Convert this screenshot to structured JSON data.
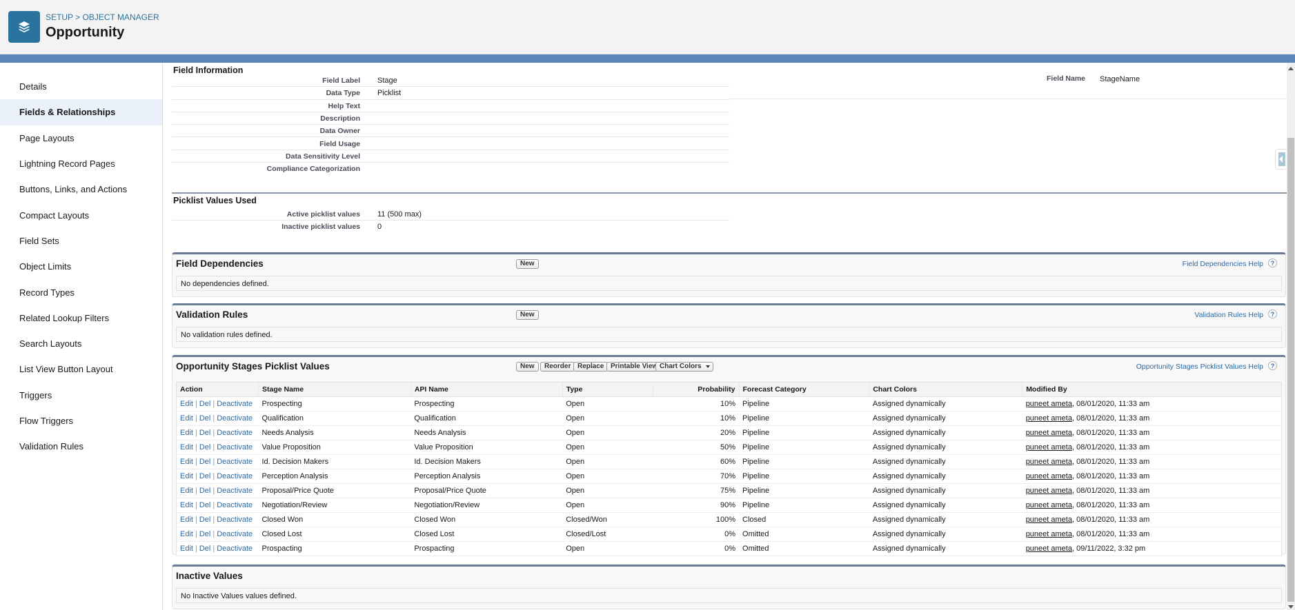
{
  "header": {
    "breadcrumb": {
      "setup": "SETUP",
      "separator": " > ",
      "object_manager": "OBJECT MANAGER"
    },
    "title": "Opportunity",
    "logo_icon": "layers-icon"
  },
  "sidebar": {
    "items": [
      {
        "label": "Details",
        "active": false
      },
      {
        "label": "Fields & Relationships",
        "active": true
      },
      {
        "label": "Page Layouts",
        "active": false
      },
      {
        "label": "Lightning Record Pages",
        "active": false
      },
      {
        "label": "Buttons, Links, and Actions",
        "active": false
      },
      {
        "label": "Compact Layouts",
        "active": false
      },
      {
        "label": "Field Sets",
        "active": false
      },
      {
        "label": "Object Limits",
        "active": false
      },
      {
        "label": "Record Types",
        "active": false
      },
      {
        "label": "Related Lookup Filters",
        "active": false
      },
      {
        "label": "Search Layouts",
        "active": false
      },
      {
        "label": "List View Button Layout",
        "active": false
      },
      {
        "label": "Triggers",
        "active": false
      },
      {
        "label": "Flow Triggers",
        "active": false
      },
      {
        "label": "Validation Rules",
        "active": false
      }
    ]
  },
  "field_info": {
    "heading": "Field Information",
    "rows": [
      {
        "label": "Field Label",
        "value": "Stage"
      },
      {
        "label": "Data Type",
        "value": "Picklist"
      },
      {
        "label": "Help Text",
        "value": ""
      },
      {
        "label": "Description",
        "value": ""
      },
      {
        "label": "Data Owner",
        "value": ""
      },
      {
        "label": "Field Usage",
        "value": ""
      },
      {
        "label": "Data Sensitivity Level",
        "value": ""
      },
      {
        "label": "Compliance Categorization",
        "value": ""
      }
    ],
    "field_name_label": "Field Name",
    "field_name_value": "StageName"
  },
  "picklist_used": {
    "heading": "Picklist Values Used",
    "rows": [
      {
        "label": "Active picklist values",
        "value": "11 (500 max)"
      },
      {
        "label": "Inactive picklist values",
        "value": "0"
      }
    ]
  },
  "field_dependencies": {
    "heading": "Field Dependencies",
    "new_label": "New",
    "help_label": "Field Dependencies Help",
    "empty_text": "No dependencies defined."
  },
  "validation_rules": {
    "heading": "Validation Rules",
    "new_label": "New",
    "help_label": "Validation Rules Help",
    "empty_text": "No validation rules defined."
  },
  "stages": {
    "heading": "Opportunity Stages Picklist Values",
    "buttons": {
      "new": "New",
      "reorder": "Reorder",
      "replace": "Replace",
      "printable": "Printable View",
      "chart_colors": "Chart Colors"
    },
    "help_label": "Opportunity Stages Picklist Values Help",
    "columns": [
      "Action",
      "Stage Name",
      "API Name",
      "Type",
      "Probability",
      "Forecast Category",
      "Chart Colors",
      "Modified By"
    ],
    "action_links": {
      "edit": "Edit",
      "del": "Del",
      "deactivate": "Deactivate"
    },
    "rows": [
      {
        "stage": "Prospecting",
        "api": "Prospecting",
        "type": "Open",
        "probability": "10%",
        "forecast": "Pipeline",
        "color": "Assigned dynamically",
        "user": "puneet ameta",
        "date": ", 08/01/2020, 11:33 am"
      },
      {
        "stage": "Qualification",
        "api": "Qualification",
        "type": "Open",
        "probability": "10%",
        "forecast": "Pipeline",
        "color": "Assigned dynamically",
        "user": "puneet ameta",
        "date": ", 08/01/2020, 11:33 am"
      },
      {
        "stage": "Needs Analysis",
        "api": "Needs Analysis",
        "type": "Open",
        "probability": "20%",
        "forecast": "Pipeline",
        "color": "Assigned dynamically",
        "user": "puneet ameta",
        "date": ", 08/01/2020, 11:33 am"
      },
      {
        "stage": "Value Proposition",
        "api": "Value Proposition",
        "type": "Open",
        "probability": "50%",
        "forecast": "Pipeline",
        "color": "Assigned dynamically",
        "user": "puneet ameta",
        "date": ", 08/01/2020, 11:33 am"
      },
      {
        "stage": "Id. Decision Makers",
        "api": "Id. Decision Makers",
        "type": "Open",
        "probability": "60%",
        "forecast": "Pipeline",
        "color": "Assigned dynamically",
        "user": "puneet ameta",
        "date": ", 08/01/2020, 11:33 am"
      },
      {
        "stage": "Perception Analysis",
        "api": "Perception Analysis",
        "type": "Open",
        "probability": "70%",
        "forecast": "Pipeline",
        "color": "Assigned dynamically",
        "user": "puneet ameta",
        "date": ", 08/01/2020, 11:33 am"
      },
      {
        "stage": "Proposal/Price Quote",
        "api": "Proposal/Price Quote",
        "type": "Open",
        "probability": "75%",
        "forecast": "Pipeline",
        "color": "Assigned dynamically",
        "user": "puneet ameta",
        "date": ", 08/01/2020, 11:33 am"
      },
      {
        "stage": "Negotiation/Review",
        "api": "Negotiation/Review",
        "type": "Open",
        "probability": "90%",
        "forecast": "Pipeline",
        "color": "Assigned dynamically",
        "user": "puneet ameta",
        "date": ", 08/01/2020, 11:33 am"
      },
      {
        "stage": "Closed Won",
        "api": "Closed Won",
        "type": "Closed/Won",
        "probability": "100%",
        "forecast": "Closed",
        "color": "Assigned dynamically",
        "user": "puneet ameta",
        "date": ", 08/01/2020, 11:33 am"
      },
      {
        "stage": "Closed Lost",
        "api": "Closed Lost",
        "type": "Closed/Lost",
        "probability": "0%",
        "forecast": "Omitted",
        "color": "Assigned dynamically",
        "user": "puneet ameta",
        "date": ", 08/01/2020, 11:33 am"
      },
      {
        "stage": "Prospacting",
        "api": "Prospacting",
        "type": "Open",
        "probability": "0%",
        "forecast": "Omitted",
        "color": "Assigned dynamically",
        "user": "puneet ameta",
        "date": ", 09/11/2022, 3:32 pm"
      }
    ]
  },
  "inactive_values": {
    "heading": "Inactive Values",
    "empty_text": "No Inactive Values values defined."
  },
  "colors": {
    "brand": "#2a739e",
    "link": "#2a6aa6",
    "band": "#5b86b8",
    "section_border": "#6b7b93"
  }
}
